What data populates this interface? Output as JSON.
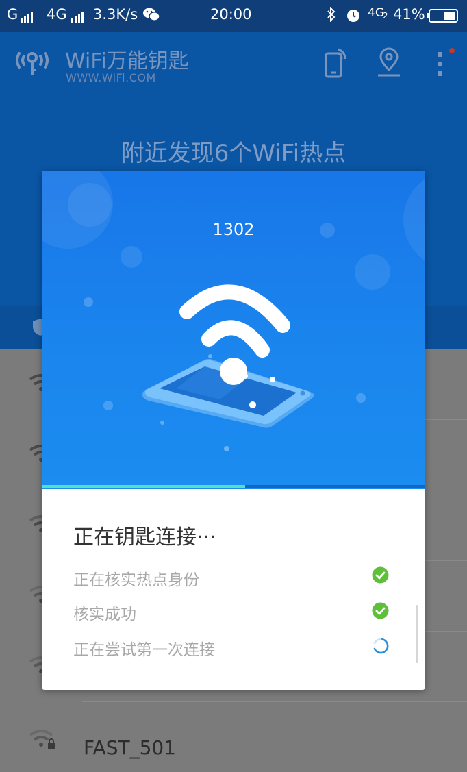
{
  "status_bar": {
    "carrier1": "G",
    "carrier2": "4G",
    "speed": "3.3K/s",
    "time": "20:00",
    "network_type": "4G",
    "sim_index": "2",
    "battery": "41%",
    "icons": [
      "signal-icon",
      "wechat-icon",
      "bluetooth-icon",
      "alarm-icon",
      "battery-icon"
    ]
  },
  "header": {
    "title": "WiFi万能钥匙",
    "subtitle": "WWW.WiFi.COM",
    "heading": "附近发现6个WiFi热点",
    "icons": [
      "wifi-key-logo-icon",
      "phone-share-icon",
      "location-pin-icon",
      "more-vert-icon"
    ]
  },
  "network_list": {
    "visible_name": "FAST_501"
  },
  "dialog": {
    "ssid": "1302",
    "progress": 0.53,
    "title": "正在钥匙连接···",
    "steps": [
      {
        "label": "正在核实热点身份",
        "status": "done"
      },
      {
        "label": "核实成功",
        "status": "done"
      },
      {
        "label": "正在尝试第一次连接",
        "status": "loading"
      }
    ]
  },
  "colors": {
    "header_bg": "#0a56a5",
    "hero_blue": "#1b86ee",
    "progress": "#4ee3c8",
    "check_green": "#5fbf3a",
    "spinner_blue": "#2c8fd6"
  }
}
